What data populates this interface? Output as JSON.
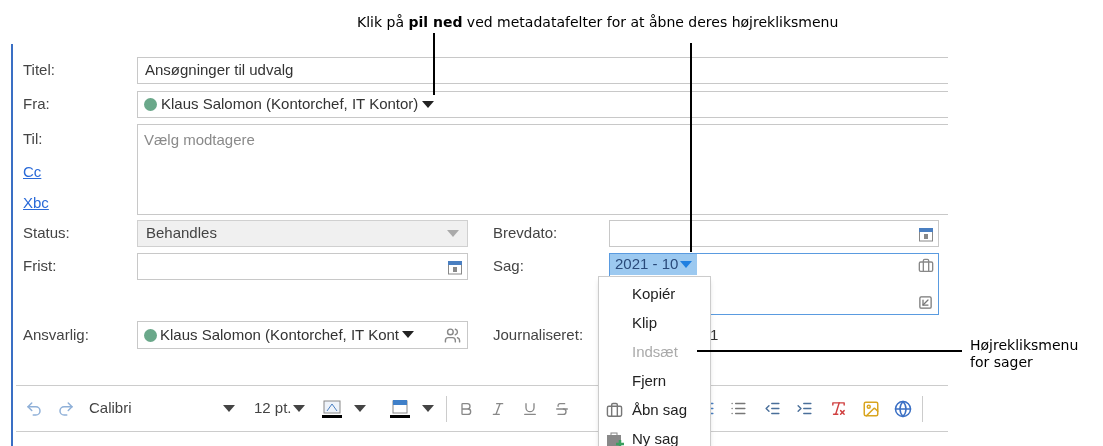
{
  "annotation_top": "Klik på **pil ned** ved metadatafelter for at åbne deres højrekliksmenu",
  "form": {
    "title": {
      "label": "Titel:",
      "value": "Ansøgninger til udvalg"
    },
    "from": {
      "label": "Fra:",
      "value": "Klaus Salomon (Kontorchef, IT Kontor)"
    },
    "to": {
      "label": "Til:",
      "placeholder": "Vælg modtagere"
    },
    "cc": "Cc",
    "bcc": "Xbc",
    "status": {
      "label": "Status:",
      "value": "Behandles"
    },
    "deadline": {
      "label": "Frist:"
    },
    "letter_date": {
      "label": "Brevdato:"
    },
    "case": {
      "label": "Sag:",
      "value": "2021 - 10"
    },
    "responsible": {
      "label": "Ansvarlig:",
      "value": "Klaus Salomon (Kontorchef, IT Kont"
    },
    "journalized": {
      "label": "Journaliseret:",
      "value": "1"
    }
  },
  "toolbar": {
    "font": "Calibri",
    "size": "12 pt."
  },
  "context_menu": [
    {
      "label": "Kopiér",
      "kind": "plain",
      "disabled": false
    },
    {
      "label": "Klip",
      "kind": "plain",
      "disabled": false
    },
    {
      "label": "Indsæt",
      "kind": "plain",
      "disabled": true
    },
    {
      "label": "Fjern",
      "kind": "plain",
      "disabled": false
    },
    {
      "label": "Åbn sag",
      "kind": "open_case",
      "disabled": false
    },
    {
      "label": "Ny sag",
      "kind": "new_case",
      "disabled": false
    }
  ],
  "annotation_right": "Højrekliksmenu for sager"
}
